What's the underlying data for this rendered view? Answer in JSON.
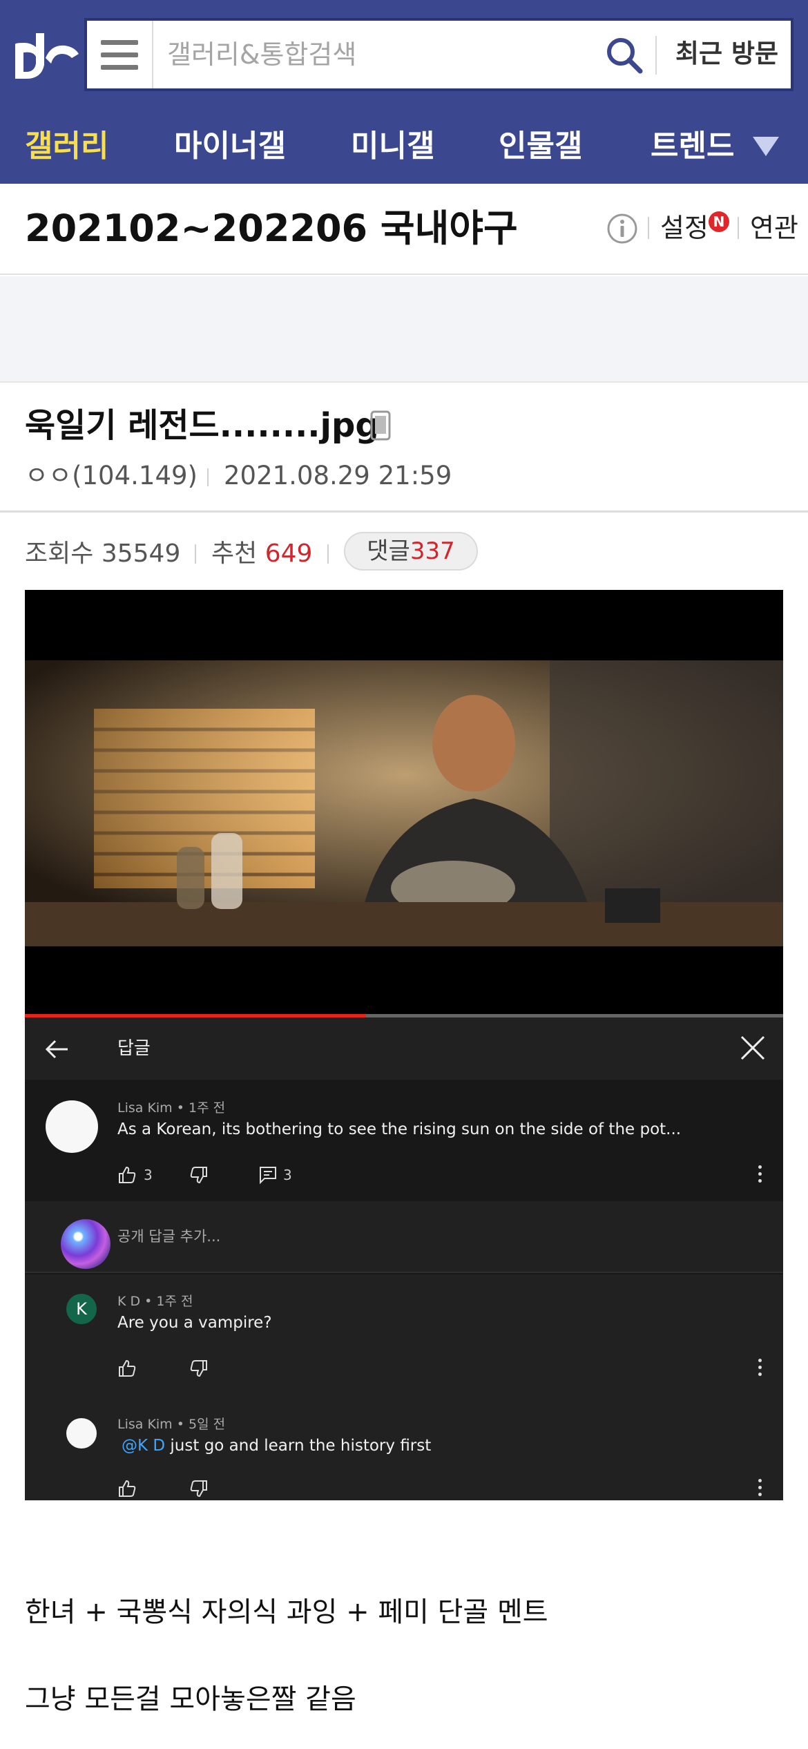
{
  "header": {
    "search_placeholder": "갤러리&통합검색",
    "recent_label": "최근 방문"
  },
  "nav": {
    "items": [
      "갤러리",
      "마이너갤",
      "미니갤",
      "인물갤",
      "트렌드"
    ],
    "active_index": 0
  },
  "gallery": {
    "title": "202102~202206 국내야구",
    "settings_label": "설정",
    "new_badge": "N",
    "related_label": "연관"
  },
  "post": {
    "title": "욱일기 레전드........jpg",
    "author": "ㅇㅇ(104.149)",
    "date": "2021.08.29 21:59",
    "views_label": "조회수",
    "views": "35549",
    "recommend_label": "추천",
    "recommend": "649",
    "comments_label": "댓글",
    "comments": "337"
  },
  "embedded": {
    "video_progress": 0.45,
    "reply_header_title": "답글",
    "main_comment": {
      "meta": "Lisa Kim • 1주 전",
      "text": "As a Korean, its bothering to see the rising sun on the side of the pot...",
      "likes": "3",
      "replies": "3"
    },
    "add_reply_placeholder": "공개 답글 추가...",
    "replies": [
      {
        "avatar_letter": "K",
        "meta": "K D • 1주 전",
        "text": "Are you a vampire?"
      },
      {
        "meta": "Lisa Kim • 5일 전",
        "mention": "@K D",
        "text": "just go and learn the history first"
      }
    ]
  },
  "body": {
    "lines": [
      "한녀 + 국뽕식 자의식 과잉 + 페미 단골 멘트",
      "그냥 모든걸 모아놓은짤 같음"
    ]
  },
  "colors": {
    "header_bg": "#3b4890",
    "active_nav": "#f9e04a",
    "accent_red": "#d0262c",
    "youtube_red": "#e1251b"
  }
}
